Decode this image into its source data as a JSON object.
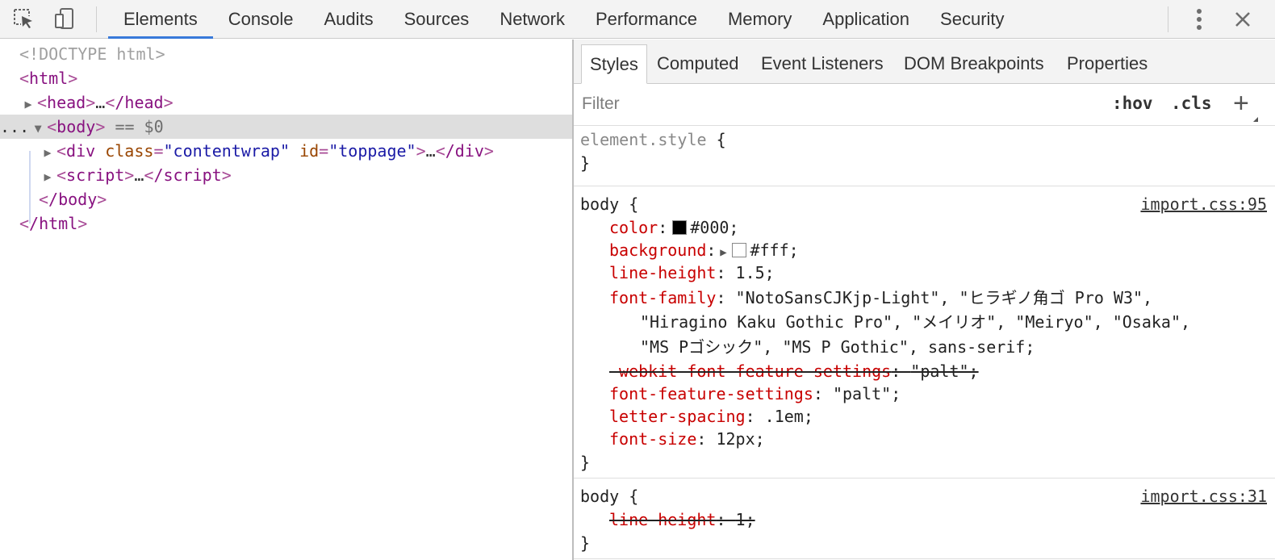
{
  "toolbar": {
    "tabs": [
      {
        "label": "Elements",
        "active": true
      },
      {
        "label": "Console"
      },
      {
        "label": "Audits"
      },
      {
        "label": "Sources"
      },
      {
        "label": "Network"
      },
      {
        "label": "Performance"
      },
      {
        "label": "Memory"
      },
      {
        "label": "Application"
      },
      {
        "label": "Security"
      }
    ],
    "icons": [
      "inspect-element-icon",
      "device-toolbar-icon",
      "more-vertical-icon",
      "close-icon"
    ],
    "accent_color": "#3879d9"
  },
  "dom": {
    "doctype": "<!DOCTYPE html>",
    "html_open": "html",
    "head_tag": "head",
    "head_close": "/head",
    "ellipsis": "…",
    "body_tag": "body",
    "selected_marker": "== $0",
    "selected_prefix": "...",
    "div_tag": "div",
    "div_attr1_name": "class",
    "div_attr1_value": "\"contentwrap\"",
    "div_attr2_name": "id",
    "div_attr2_value": "\"toppage\"",
    "div_close": "/div",
    "script_tag": "script",
    "script_close": "/script",
    "body_close": "/body",
    "html_close": "/html"
  },
  "sidebar": {
    "tabs": [
      {
        "label": "Styles",
        "active": true
      },
      {
        "label": "Computed"
      },
      {
        "label": "Event Listeners"
      },
      {
        "label": "DOM Breakpoints"
      },
      {
        "label": "Properties"
      }
    ],
    "filter_placeholder": "Filter",
    "hov": ":hov",
    "cls": ".cls",
    "plus": "+"
  },
  "rules": {
    "element_style": {
      "selector": "element.style",
      "open": "{",
      "close": "}"
    },
    "body1": {
      "selector": "body",
      "open": "{",
      "source": "import.css:95",
      "color": {
        "prop": "color",
        "value": "#000;",
        "swatch": "#000000"
      },
      "background": {
        "prop": "background",
        "value": "#fff;",
        "swatch": "#ffffff"
      },
      "line_height": {
        "prop": "line-height",
        "value": "1.5;"
      },
      "font_family": {
        "prop": "font-family",
        "value_1": "\"NotoSansCJKjp-Light\", \"ヒラギノ角ゴ Pro W3\",",
        "value_2": "\"Hiragino Kaku Gothic Pro\", \"メイリオ\", \"Meiryo\", \"Osaka\",",
        "value_3": "\"MS Pゴシック\", \"MS P Gothic\", sans-serif;"
      },
      "webkit_ffs": {
        "prop": "-webkit-font-feature-settings",
        "value": "\"palt\";",
        "overridden": true
      },
      "ffs": {
        "prop": "font-feature-settings",
        "value": "\"palt\";"
      },
      "letter_spacing": {
        "prop": "letter-spacing",
        "value": ".1em;"
      },
      "font_size": {
        "prop": "font-size",
        "value": "12px;"
      },
      "close": "}"
    },
    "body2": {
      "selector": "body",
      "open": "{",
      "source": "import.css:31",
      "line_height": {
        "prop": "line-height",
        "value": "1;",
        "overridden": true
      },
      "close": "}"
    }
  }
}
